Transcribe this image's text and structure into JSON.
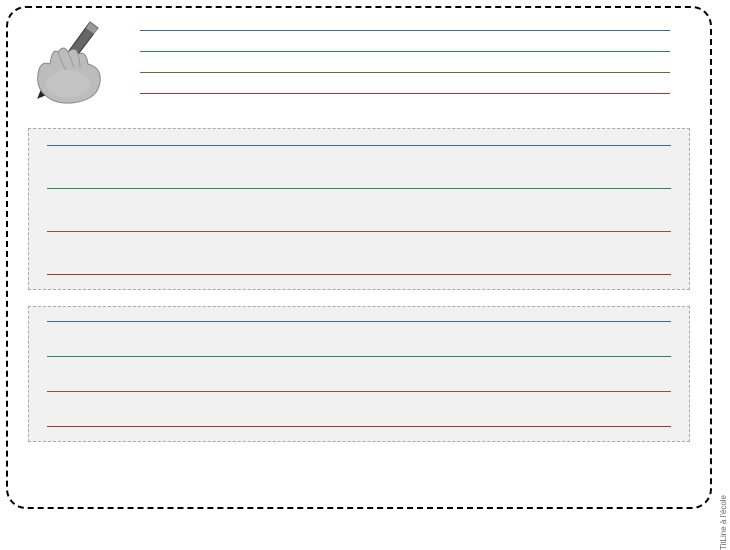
{
  "colors": {
    "line_blue": "#3a6a8a",
    "line_green": "#2a8a4a",
    "line_brown": "#8a5a2a",
    "line_red": "#b03030",
    "box_bg": "#f1f1f1",
    "box_border": "#aaaaaa"
  },
  "title_lines": [
    {
      "color_key": "line_blue"
    },
    {
      "color_key": "line_green"
    },
    {
      "color_key": "line_brown"
    },
    {
      "color_key": "line_red"
    }
  ],
  "boxes": [
    {
      "id": "box1",
      "line_colors": [
        "line_blue",
        "line_green",
        "line_brown",
        "line_red"
      ]
    },
    {
      "id": "box2",
      "line_colors": [
        "line_blue",
        "line_green",
        "line_brown",
        "line_red"
      ]
    }
  ],
  "credit_text": "TitLine à l'école",
  "icon_label": "hand-writing"
}
